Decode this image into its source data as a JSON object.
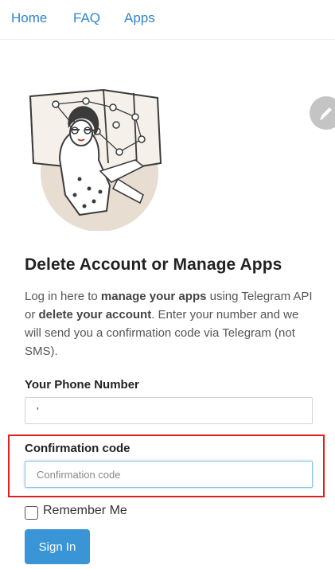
{
  "nav": {
    "items": [
      "Home",
      "FAQ",
      "Apps"
    ]
  },
  "page": {
    "title": "Delete Account or Manage Apps",
    "desc": {
      "p1": "Log in here to ",
      "b1": "manage your apps",
      "p2": " using Telegram API or ",
      "b2": "delete your account",
      "p3": ". Enter your number and we will send you a confirmation code via Telegram (not SMS)."
    }
  },
  "form": {
    "phone_label": "Your Phone Number",
    "phone_value": "'",
    "code_label": "Confirmation code",
    "code_placeholder": "Confirmation code",
    "code_value": "",
    "remember_label": "Remember Me",
    "remember_checked": false,
    "submit_label": "Sign In"
  },
  "colors": {
    "link": "#2f86c7",
    "button": "#3a95d6",
    "highlight": "#e02020"
  },
  "icons": {
    "fab": "pencil-icon",
    "illustration": "telegram-network-illustration"
  }
}
